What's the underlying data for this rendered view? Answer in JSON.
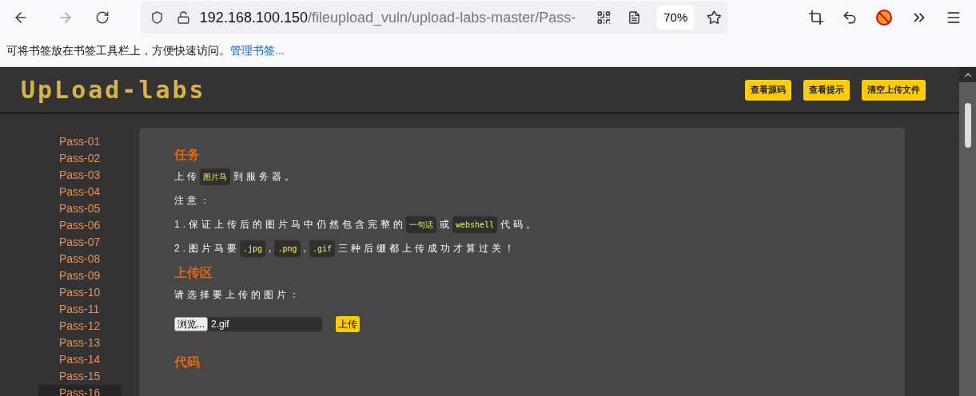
{
  "browser": {
    "url_host": "192.168.100.150",
    "url_path": "/fileupload_vuln/upload-labs-master/Pass-",
    "zoom": "70%",
    "bookmark_hint": "可将书签放在书签工具栏上，方便快速访问。",
    "bookmark_link": "管理书签..."
  },
  "header": {
    "logo": "UpLoad-labs",
    "buttons": [
      "查看源码",
      "查看提示",
      "清空上传文件"
    ]
  },
  "sidebar": {
    "items": [
      {
        "label": "Pass-01",
        "selected": false
      },
      {
        "label": "Pass-02",
        "selected": false
      },
      {
        "label": "Pass-03",
        "selected": false
      },
      {
        "label": "Pass-04",
        "selected": false
      },
      {
        "label": "Pass-05",
        "selected": false
      },
      {
        "label": "Pass-06",
        "selected": false
      },
      {
        "label": "Pass-07",
        "selected": false
      },
      {
        "label": "Pass-08",
        "selected": false
      },
      {
        "label": "Pass-09",
        "selected": false
      },
      {
        "label": "Pass-10",
        "selected": false
      },
      {
        "label": "Pass-11",
        "selected": false
      },
      {
        "label": "Pass-12",
        "selected": false
      },
      {
        "label": "Pass-13",
        "selected": false
      },
      {
        "label": "Pass-14",
        "selected": false
      },
      {
        "label": "Pass-15",
        "selected": false
      },
      {
        "label": "Pass-16",
        "selected": true
      }
    ]
  },
  "task": {
    "title": "任务",
    "lines": [
      [
        {
          "kind": "text",
          "text": "上传"
        },
        {
          "kind": "code",
          "text": "图片马"
        },
        {
          "kind": "text",
          "text": "到服务器。"
        }
      ],
      [
        {
          "kind": "text",
          "text": "注意："
        }
      ],
      [
        {
          "kind": "text",
          "text": "1.保证上传后的图片马中仍然包含完整的"
        },
        {
          "kind": "code",
          "text": "一句话"
        },
        {
          "kind": "text",
          "text": "或"
        },
        {
          "kind": "code",
          "text": "webshell"
        },
        {
          "kind": "text",
          "text": "代码。"
        }
      ],
      [
        {
          "kind": "text",
          "text": "2.图片马要"
        },
        {
          "kind": "code",
          "text": ".jpg"
        },
        {
          "kind": "text",
          "text": ","
        },
        {
          "kind": "code",
          "text": ".png"
        },
        {
          "kind": "text",
          "text": ","
        },
        {
          "kind": "code",
          "text": ".gif"
        },
        {
          "kind": "text",
          "text": "三种后缀都上传成功才算过关！"
        }
      ]
    ]
  },
  "upload": {
    "title": "上传区",
    "prompt": "请选择要上传的图片：",
    "browse_button": "浏览...",
    "file_name": "2.gif",
    "submit_button": "上传"
  },
  "code": {
    "title": "代码"
  }
}
